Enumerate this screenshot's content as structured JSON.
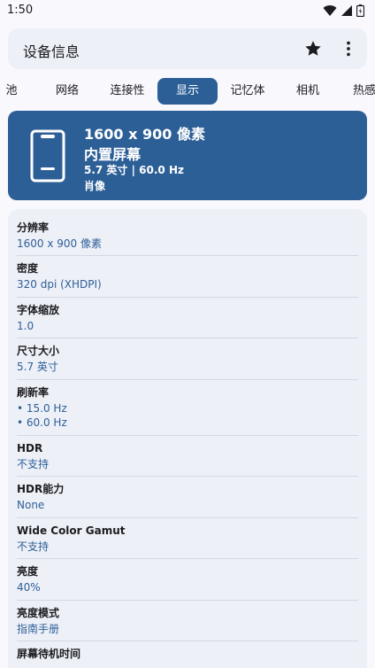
{
  "status": {
    "time": "1:50"
  },
  "toolbar": {
    "title": "设备信息"
  },
  "tabs": [
    {
      "label": "池"
    },
    {
      "label": "网络"
    },
    {
      "label": "连接性"
    },
    {
      "label": "显示"
    },
    {
      "label": "记忆体"
    },
    {
      "label": "相机"
    },
    {
      "label": "热感"
    }
  ],
  "active_tab": "显示",
  "hero": {
    "title": "1600 x 900 像素",
    "subtitle": "内置屏幕",
    "line3": "5.7 英寸 | 60.0 Hz",
    "line4": "肖像"
  },
  "details": [
    {
      "label": "分辨率",
      "values": [
        "1600 x 900 像素"
      ]
    },
    {
      "label": "密度",
      "values": [
        "320 dpi (XHDPI)"
      ]
    },
    {
      "label": "字体缩放",
      "values": [
        "1.0"
      ]
    },
    {
      "label": "尺寸大小",
      "values": [
        "5.7 英寸"
      ]
    },
    {
      "label": "刷新率",
      "values": [
        "• 15.0 Hz",
        "• 60.0 Hz"
      ]
    },
    {
      "label": "HDR",
      "values": [
        "不支持"
      ]
    },
    {
      "label": "HDR能力",
      "values": [
        "None"
      ]
    },
    {
      "label": "Wide Color Gamut",
      "values": [
        "不支持"
      ]
    },
    {
      "label": "亮度",
      "values": [
        "40%"
      ]
    },
    {
      "label": "亮度模式",
      "values": [
        "指南手册"
      ]
    },
    {
      "label": "屏幕待机时间",
      "values": [
        ""
      ]
    }
  ],
  "colors": {
    "accent": "#2d5f97",
    "surface": "#eef0f8",
    "background": "#f9f9fd"
  }
}
